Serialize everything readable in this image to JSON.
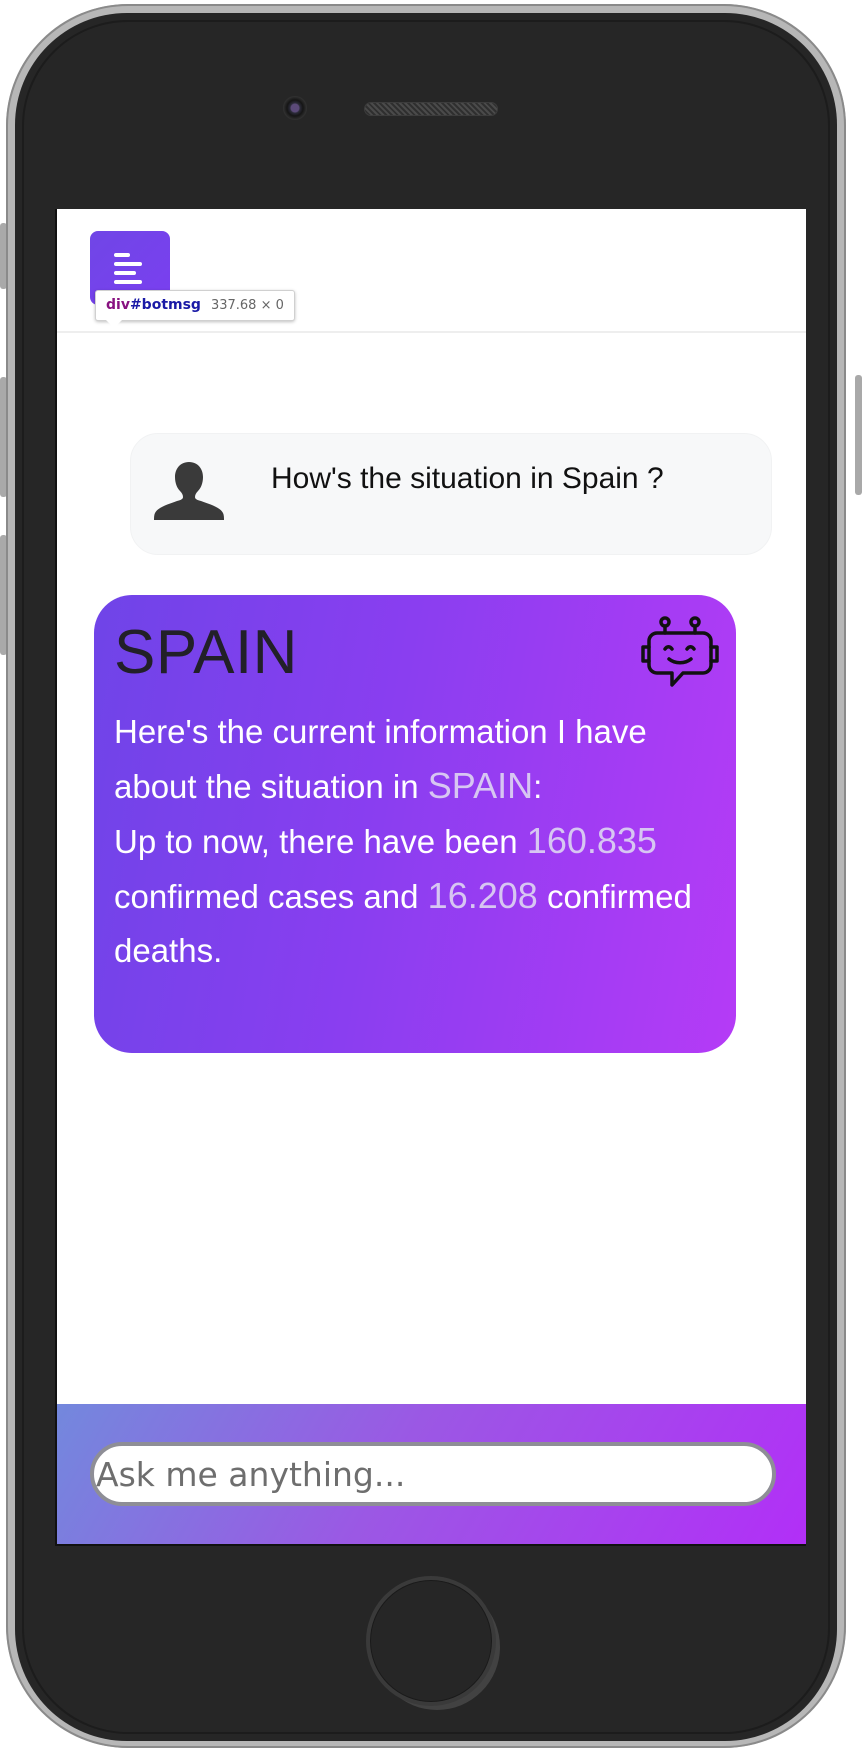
{
  "devtools": {
    "tag": "div",
    "id": "#botmsg",
    "dims": "337.68 × 0"
  },
  "user_message": {
    "text": "How's the situation in Spain ?"
  },
  "bot_message": {
    "country": "SPAIN",
    "line1": "Here's the current information I have about the situation in ",
    "country_inline": "SPAIN",
    "colon": ":",
    "line2": "Up to now, there have been ",
    "cases": "160.835",
    "line3": " confirmed cases and ",
    "deaths": "16.208",
    "line4": " confirmed deaths."
  },
  "input": {
    "placeholder": "Ask me anything..."
  },
  "icons": {
    "menu": "menu-lines-icon",
    "user": "user-silhouette-icon",
    "bot": "robot-chat-icon"
  },
  "colors": {
    "accent": "#7046e6",
    "bot_gradient_start": "#6f44e8",
    "bot_gradient_end": "#b53bf6",
    "highlight": "#d7c6f2"
  }
}
